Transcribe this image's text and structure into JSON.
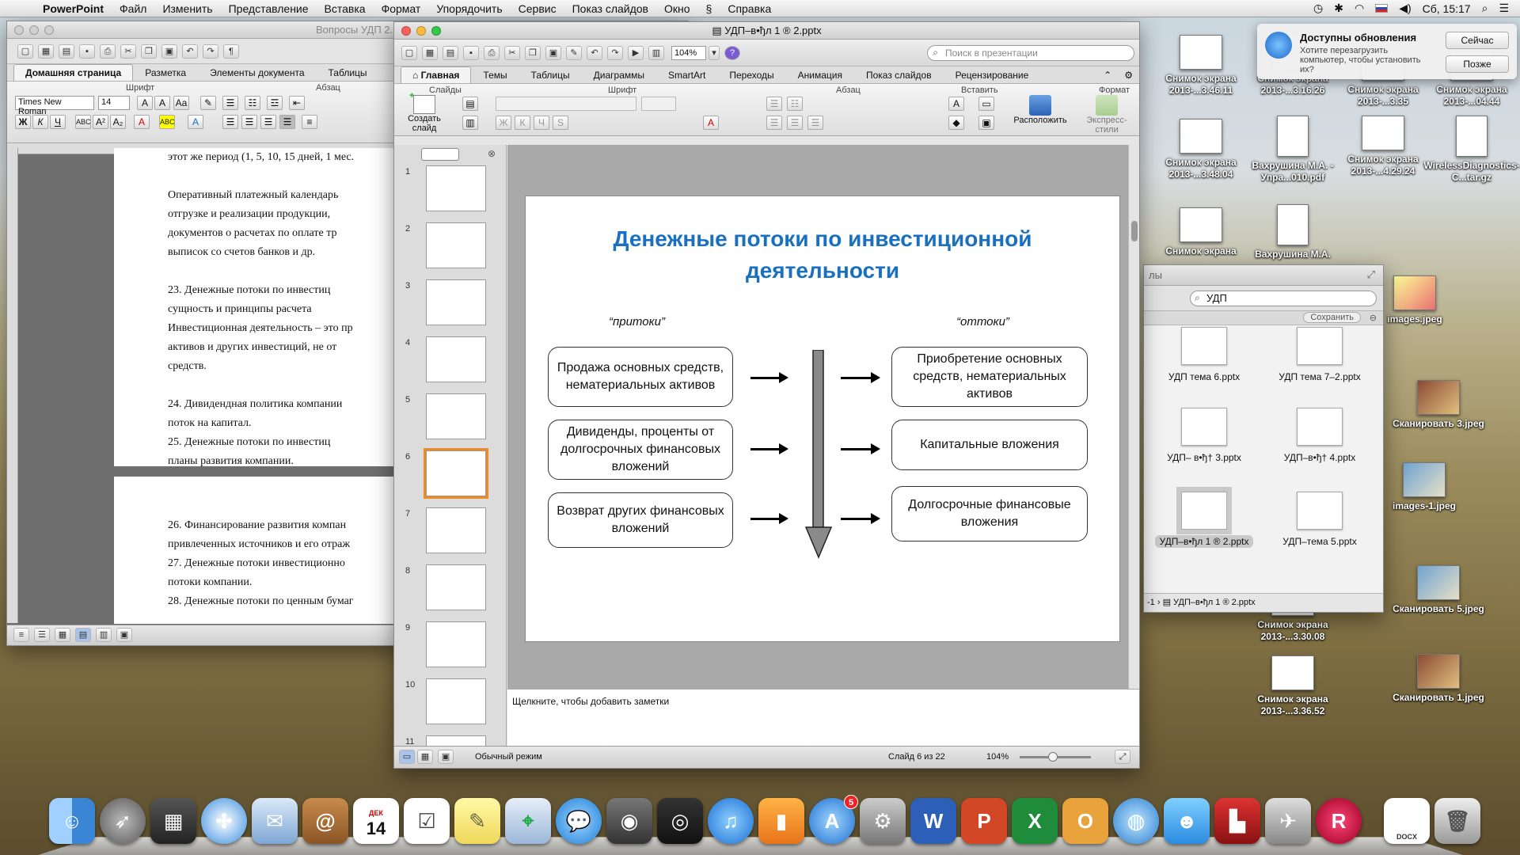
{
  "menubar": {
    "app": "PowerPoint",
    "items": [
      "Файл",
      "Изменить",
      "Представление",
      "Вставка",
      "Формат",
      "Упорядочить",
      "Сервис",
      "Показ слайдов",
      "Окно",
      "Справка"
    ],
    "clock": "Сб, 15:17"
  },
  "word": {
    "title": "Вопросы УДП 2...",
    "tabs": [
      "Домашняя страница",
      "Разметка",
      "Элементы документа",
      "Таблицы"
    ],
    "group_font": "Шрифт",
    "group_para": "Абзац",
    "font_name": "Times New Roman",
    "font_size": "14",
    "page1": [
      "этот же период (1, 5, 10, 15 дней, 1 мес.",
      "",
      "Оперативный платежный календарь",
      "отгрузке и реализации продукции,",
      "документов о расчетах по оплате тр",
      "выписок со счетов банков и др.",
      "",
      "23. Денежные потоки по инвестиц",
      "сущность и принципы расчета",
      "Инвестиционная деятельность – это пр",
      "активов и других инвестиций, не от",
      "средств.",
      "",
      "24. Дивидендная политика компании",
      "поток на капитал.",
      "25. Денежные потоки по инвестиц",
      "планы развития компании."
    ],
    "page2": [
      "26. Финансирование развития компан",
      "привлеченных источников и его отраж",
      "27. Денежные потоки инвестиционно",
      "потоки компании.",
      "28. Денежные потоки по ценным бумаг"
    ]
  },
  "ppt": {
    "title": "УДП–в•ђл 1 ® 2.pptx",
    "zoom_field": "104%",
    "search_placeholder": "Поиск в презентации",
    "tabs": [
      "Главная",
      "Темы",
      "Таблицы",
      "Диаграммы",
      "SmartArt",
      "Переходы",
      "Анимация",
      "Показ слайдов",
      "Рецензирование"
    ],
    "groups": {
      "slides": "Слайды",
      "font": "Шрифт",
      "para": "Абзац",
      "insert": "Вставить",
      "format": "Формат"
    },
    "new_slide": "Создать слайд",
    "arrange": "Расположить",
    "quick_styles": "Экспресс-стили",
    "slide_numbers": [
      "1",
      "2",
      "3",
      "4",
      "5",
      "6",
      "7",
      "8",
      "9",
      "10",
      "11"
    ],
    "selected_slide": "6",
    "slide": {
      "title": "Денежные потоки по инвестиционной деятельности",
      "inflows_label": "“притоки”",
      "outflows_label": "“оттоки”",
      "inflows": [
        "Продажа основных средств, нематериальных активов",
        "Дивиденды, проценты от долгосрочных финансовых вложений",
        "Возврат других финансовых вложений"
      ],
      "outflows": [
        "Приобретение основных средств, нематериальных активов",
        "Капитальные вложения",
        "Долгосрочные финансовые вложения"
      ]
    },
    "notes_placeholder": "Щелкните, чтобы добавить заметки",
    "status_view": "Обычный режим",
    "status_slide": "Слайд 6 из 22",
    "status_zoom": "104%"
  },
  "finder": {
    "search_value": "УДП",
    "save_button": "Сохранить",
    "side_label": "лы",
    "items": [
      "УДП тема 6.pptx",
      "УДП тема 7–2.pptx",
      "УДП– в•ђ† 3.pptx",
      "УДП–в•ђ† 4.pptx",
      "УДП–в•ђл 1 ® 2.pptx",
      "УДП–тема 5.pptx"
    ],
    "path": "УДП–в•ђл 1 ® 2.pptx",
    "path_prefix": "-1"
  },
  "notification": {
    "title": "Доступны обновления",
    "text": "Хотите перезагрузить компьютер, чтобы установить их?",
    "btn_now": "Сейчас",
    "btn_later": "Позже"
  },
  "desktop": [
    {
      "name": "Снимок экрана 2013-...3.46.11",
      "kind": "doc"
    },
    {
      "name": "Снимок экрана 2013-...3.16.26",
      "kind": "doc"
    },
    {
      "name": "Снимок экрана 2013-...3.35",
      "kind": "doc"
    },
    {
      "name": "Снимок экрана 2013-...04.44",
      "kind": "doc"
    },
    {
      "name": "Снимок экрана 2013-...3.48.04",
      "kind": "doc"
    },
    {
      "name": "Вахрушина М.А. - Упра...010.pdf",
      "kind": "pdf"
    },
    {
      "name": "Снимок экрана 2013-...4.29.24",
      "kind": "doc"
    },
    {
      "name": "WirelessDiagnostics-C...tar.gz",
      "kind": "gz"
    },
    {
      "name": "Снимок экрана",
      "kind": "doc"
    },
    {
      "name": "Вахрушина М.А.",
      "kind": "pdf"
    },
    {
      "name": "images.jpeg",
      "kind": "pic3"
    },
    {
      "name": "Сканировать 3.jpeg",
      "kind": "pic"
    },
    {
      "name": "images-1.jpeg",
      "kind": "pic2"
    },
    {
      "name": "Сканировать 5.jpeg",
      "kind": "pic2"
    },
    {
      "name": "Снимок экрана 2013-...3.30.08",
      "kind": "doc"
    },
    {
      "name": "Снимок экрана 2013-...3.36.52",
      "kind": "doc"
    },
    {
      "name": "Сканировать 1.jpeg",
      "kind": "pic"
    }
  ],
  "dock": {
    "calendar_month": "ДЕК",
    "calendar_day": "14",
    "appstore_badge": "5",
    "docx_label": "DOCX"
  }
}
